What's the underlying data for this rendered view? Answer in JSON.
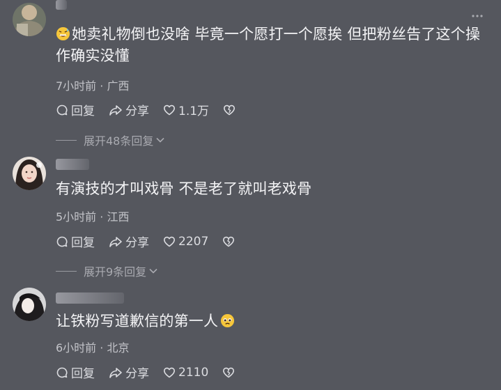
{
  "comments": [
    {
      "text": "她卖礼物倒也没啥  毕竟一个愿打一个愿挨   但把粉丝告了这个操作确实没懂",
      "meta": "7小时前 · 广西",
      "reply_label": "回复",
      "share_label": "分享",
      "like_count": "1.1万",
      "expand_label": "展开48条回复"
    },
    {
      "text": "有演技的才叫戏骨 不是老了就叫老戏骨",
      "meta": "5小时前 · 江西",
      "reply_label": "回复",
      "share_label": "分享",
      "like_count": "2207",
      "expand_label": "展开9条回复"
    },
    {
      "text": "让铁粉写道歉信的第一人",
      "meta": "6小时前 · 北京",
      "reply_label": "回复",
      "share_label": "分享",
      "like_count": "2110"
    }
  ],
  "colors": {
    "background": "#55575e",
    "text": "#f4f4f6",
    "meta": "#c3c4c9",
    "expand": "#a9aab0"
  },
  "icons": [
    "more-icon",
    "reply-icon",
    "share-icon",
    "like-heart-icon",
    "dislike-heart-icon",
    "chevron-down-icon",
    "grin-sweat-emoji-icon",
    "pleading-emoji-icon"
  ]
}
